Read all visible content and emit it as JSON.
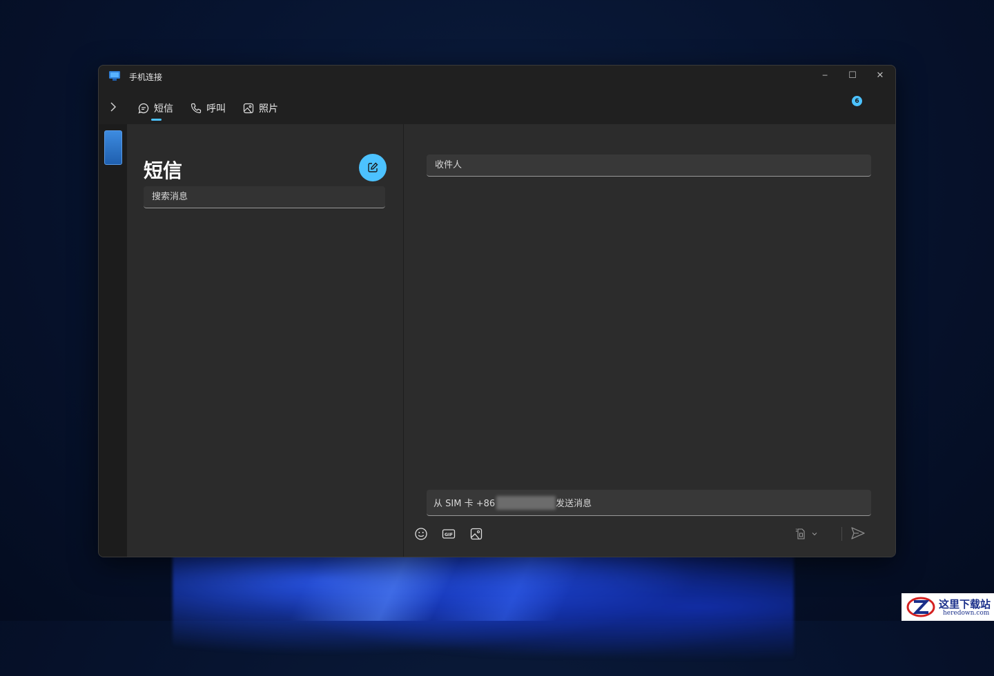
{
  "window": {
    "title": "手机连接",
    "controls": {
      "minimize": "─",
      "maximize": "☐",
      "close": "✕"
    }
  },
  "nav": {
    "tabs": [
      {
        "label": "短信",
        "icon": "message-icon",
        "selected": true
      },
      {
        "label": "呼叫",
        "icon": "phone-icon",
        "selected": false
      },
      {
        "label": "照片",
        "icon": "photo-icon",
        "selected": false
      }
    ],
    "notification_count": "6"
  },
  "messages": {
    "title": "短信",
    "search_placeholder": "搜索消息"
  },
  "conversation": {
    "recipient_placeholder": "收件人",
    "composer_prefix": "从 SIM 卡 +86",
    "composer_suffix": "发送消息"
  },
  "watermark": {
    "title": "这里下载站",
    "subtitle": "heredown.com"
  },
  "colors": {
    "accent": "#4cc2ff",
    "window_bg": "#202020",
    "panel_bg": "#2b2b2b"
  }
}
